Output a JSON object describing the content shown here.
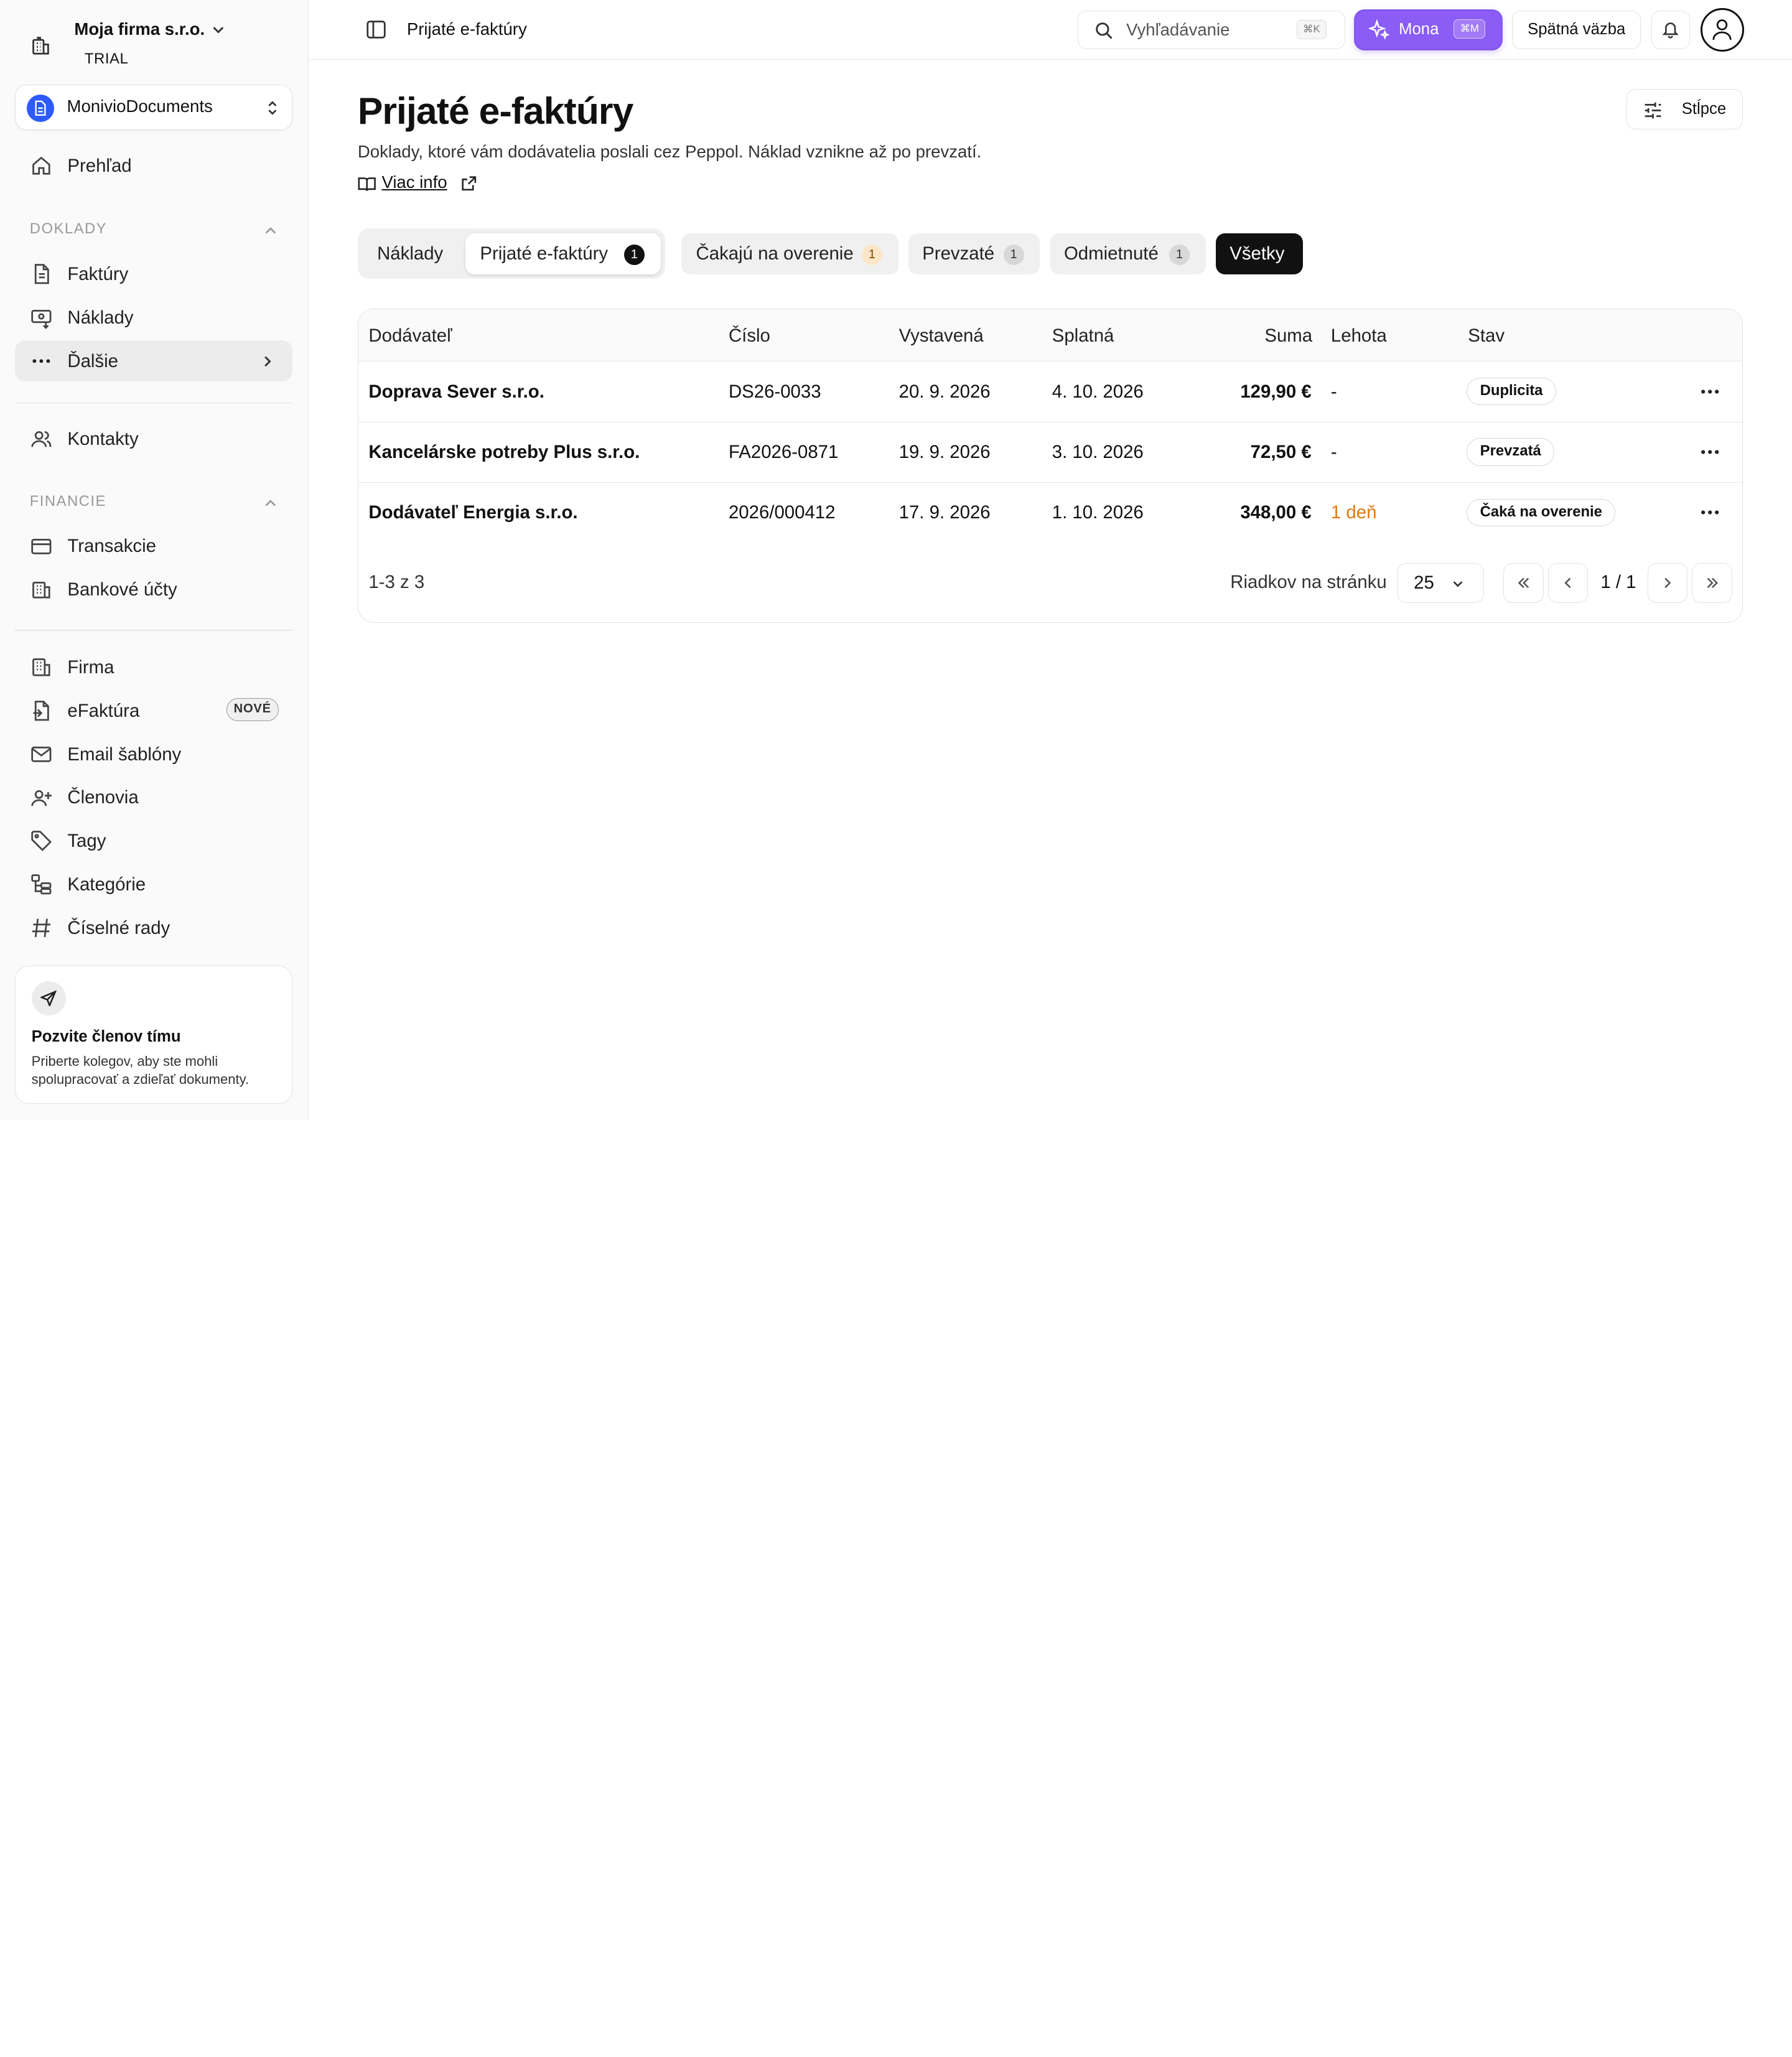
{
  "org": {
    "name": "Moja firma s.r.o.",
    "plan": "TRIAL"
  },
  "app_switcher": {
    "name": "MonivioDocuments"
  },
  "sidebar": {
    "overview": "Prehľad",
    "section_documents": "DOKLADY",
    "invoices": "Faktúry",
    "costs": "Náklady",
    "more": "Ďalšie",
    "contacts": "Kontakty",
    "section_finance": "FINANCIE",
    "transactions": "Transakcie",
    "bank_accounts": "Bankové účty",
    "company": "Firma",
    "einvoice": "eFaktúra",
    "einvoice_badge": "NOVÉ",
    "email_templates": "Email šablóny",
    "members": "Členovia",
    "tags": "Tagy",
    "categories": "Kategórie",
    "number_series": "Číselné rady"
  },
  "invite": {
    "title": "Pozvite členov tímu",
    "text": "Priberte kolegov, aby ste mohli spolupracovať a zdieľať dokumenty."
  },
  "topbar": {
    "title": "Prijaté e-faktúry",
    "search_placeholder": "Vyhľadávanie",
    "search_kbd": "⌘K",
    "mona_label": "Mona",
    "mona_kbd": "⌘M",
    "feedback": "Spätná väzba"
  },
  "page": {
    "title": "Prijaté e-faktúry",
    "description": "Doklady, ktoré vám dodávatelia poslali cez Peppol. Náklad vznikne až po prevzatí.",
    "more_info": "Viac info",
    "columns_button": "Stĺpce"
  },
  "tabs": {
    "costs": "Náklady",
    "received": "Prijaté e-faktúry",
    "received_count": "1",
    "pending": "Čakajú na overenie",
    "pending_count": "1",
    "accepted": "Prevzaté",
    "accepted_count": "1",
    "rejected": "Odmietnuté",
    "rejected_count": "1",
    "all": "Všetky"
  },
  "table": {
    "columns": {
      "supplier": "Dodávateľ",
      "number": "Číslo",
      "issued": "Vystavená",
      "due": "Splatná",
      "amount": "Suma",
      "deadline": "Lehota",
      "status": "Stav"
    },
    "rows": [
      {
        "supplier": "Doprava Sever s.r.o.",
        "number": "DS26-0033",
        "issued": "20. 9. 2026",
        "due": "4. 10. 2026",
        "amount": "129,90 €",
        "deadline": "-",
        "status": "Duplicita"
      },
      {
        "supplier": "Kancelárske potreby Plus s.r.o.",
        "number": "FA2026-0871",
        "issued": "19. 9. 2026",
        "due": "3. 10. 2026",
        "amount": "72,50 €",
        "deadline": "-",
        "status": "Prevzatá"
      },
      {
        "supplier": "Dodávateľ Energia s.r.o.",
        "number": "2026/000412",
        "issued": "17. 9. 2026",
        "due": "1. 10. 2026",
        "amount": "348,00 €",
        "deadline": "1 deň",
        "status": "Čaká na overenie"
      }
    ],
    "count_text": "1-3 z 3",
    "rows_per_page_label": "Riadkov na stránku",
    "rows_per_page": "25",
    "page_info": "1 / 1"
  },
  "colors": {
    "accent_purple": "#8b5cf6",
    "app_blue": "#2d5bff",
    "deadline_warning": "#e07a10",
    "pending_badge_bg": "#fbe7c8"
  }
}
